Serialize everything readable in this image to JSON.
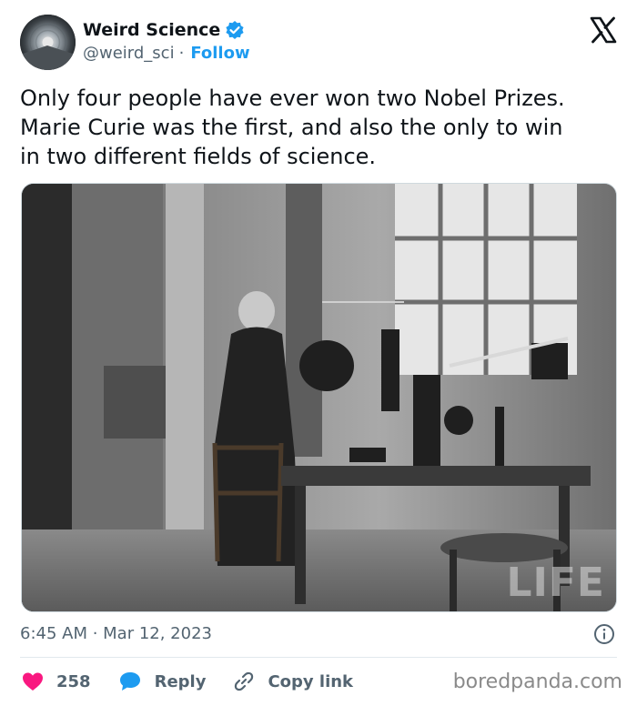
{
  "author": {
    "display_name": "Weird Science",
    "handle": "@weird_sci",
    "separator": "·",
    "follow_label": "Follow",
    "verified_color": "#1d9bf0"
  },
  "tweet": {
    "text_lines": [
      "Only four people have ever won two Nobel Prizes.",
      "Marie Curie was the first, and also the only to win",
      "in two different fields of science."
    ],
    "image_watermark": "LIFE",
    "timestamp": "6:45 AM · Mar 12, 2023"
  },
  "actions": {
    "like_count": "258",
    "reply_label": "Reply",
    "copy_link_label": "Copy link"
  },
  "site_watermark": "boredpanda.com",
  "colors": {
    "accent": "#1d9bf0",
    "like": "#f91880",
    "text_secondary": "#536471"
  },
  "icons": {
    "brand": "x-logo-icon",
    "verified": "verified-badge-icon",
    "info": "info-icon",
    "like": "heart-icon",
    "reply": "speech-bubble-icon",
    "copy": "link-icon"
  }
}
